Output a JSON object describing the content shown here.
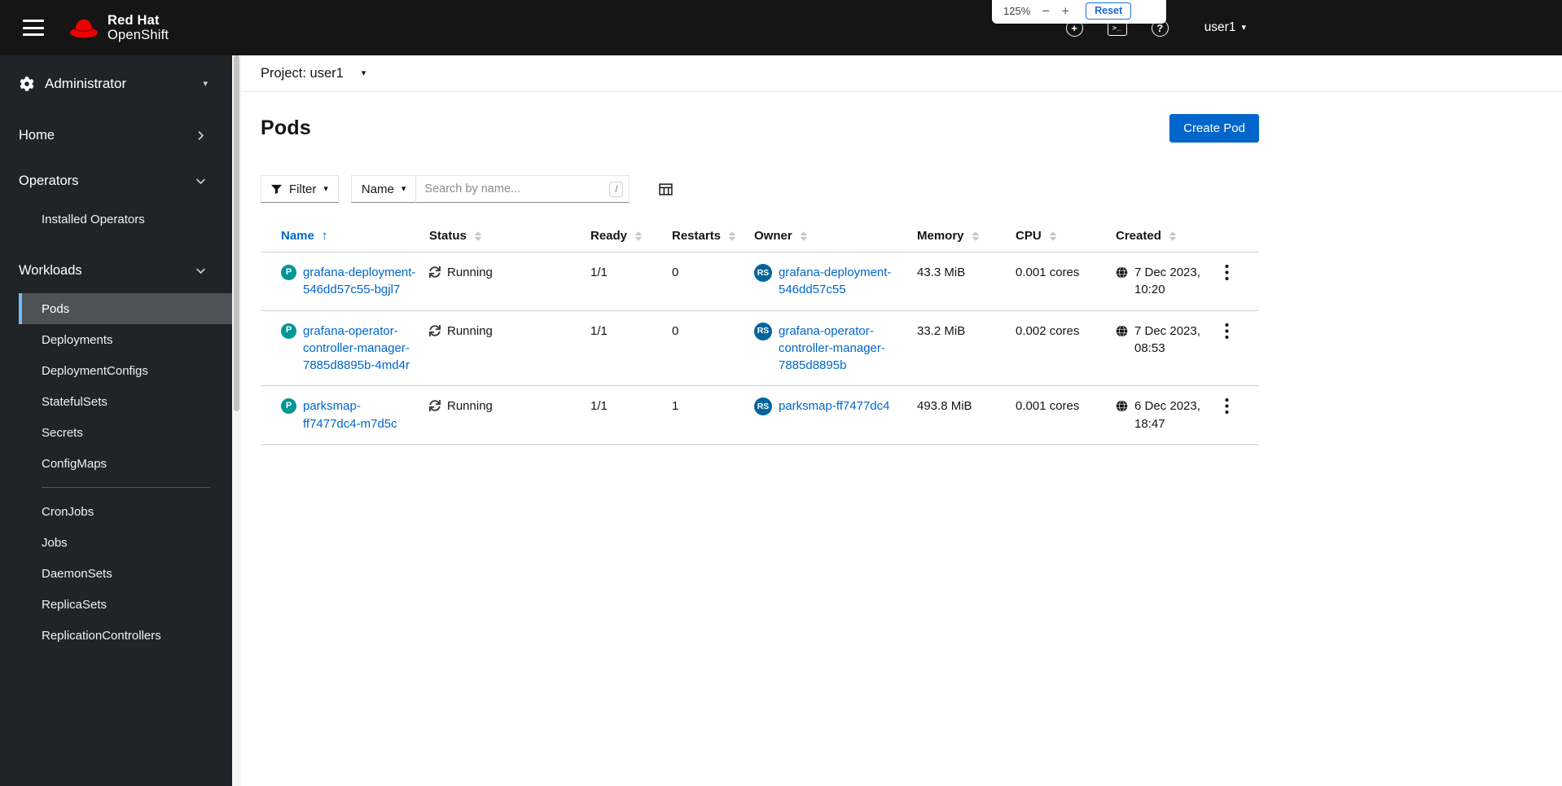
{
  "masthead": {
    "brand": {
      "line1": "Red Hat",
      "line2": "OpenShift"
    },
    "user": {
      "label": "user1"
    }
  },
  "zoom_popup": {
    "level": "125%",
    "minus": "−",
    "plus": "+",
    "reset": "Reset"
  },
  "icons": {
    "caret_down": "▾",
    "sort_ascending": "↑",
    "plus": "+",
    "question": "?",
    "terminal": ">_"
  },
  "sidebar": {
    "perspective": "Administrator",
    "sections": {
      "home": "Home",
      "operators": "Operators",
      "workloads": "Workloads"
    },
    "operators_items": [
      "Installed Operators"
    ],
    "workloads_items": [
      "Pods",
      "Deployments",
      "DeploymentConfigs",
      "StatefulSets",
      "Secrets",
      "ConfigMaps",
      "CronJobs",
      "Jobs",
      "DaemonSets",
      "ReplicaSets",
      "ReplicationControllers"
    ],
    "active_item": "Pods"
  },
  "project_bar": {
    "label": "Project: user1"
  },
  "page": {
    "title": "Pods",
    "create_button": "Create Pod"
  },
  "toolbar": {
    "filter": "Filter",
    "search_attribute": "Name",
    "search_placeholder": "Search by name...",
    "search_shortcut": "/"
  },
  "table": {
    "headers": {
      "name": "Name",
      "status": "Status",
      "ready": "Ready",
      "restarts": "Restarts",
      "owner": "Owner",
      "memory": "Memory",
      "cpu": "CPU",
      "created": "Created"
    },
    "sorted_by": "Name",
    "rows": [
      {
        "badge": "P",
        "name": "grafana-deployment-546dd57c55-bgjl7",
        "status": "Running",
        "ready": "1/1",
        "restarts": "0",
        "owner_badge": "RS",
        "owner": "grafana-deployment-546dd57c55",
        "memory": "43.3 MiB",
        "cpu": "0.001 cores",
        "created": "7 Dec 2023, 10:20"
      },
      {
        "badge": "P",
        "name": "grafana-operator-controller-manager-7885d8895b-4md4r",
        "status": "Running",
        "ready": "1/1",
        "restarts": "0",
        "owner_badge": "RS",
        "owner": "grafana-operator-controller-manager-7885d8895b",
        "memory": "33.2 MiB",
        "cpu": "0.002 cores",
        "created": "7 Dec 2023, 08:53"
      },
      {
        "badge": "P",
        "name": "parksmap-ff7477dc4-m7d5c",
        "status": "Running",
        "ready": "1/1",
        "restarts": "1",
        "owner_badge": "RS",
        "owner": "parksmap-ff7477dc4",
        "memory": "493.8 MiB",
        "cpu": "0.001 cores",
        "created": "6 Dec 2023, 18:47"
      }
    ]
  },
  "colors": {
    "masthead_bg": "#151515",
    "sidebar_bg": "#212427",
    "accent_blue": "#0066cc",
    "nav_active_border": "#73bcf7",
    "pod_badge": "#009596",
    "replicaset_badge": "#00659c",
    "brand_red": "#ee0000"
  }
}
